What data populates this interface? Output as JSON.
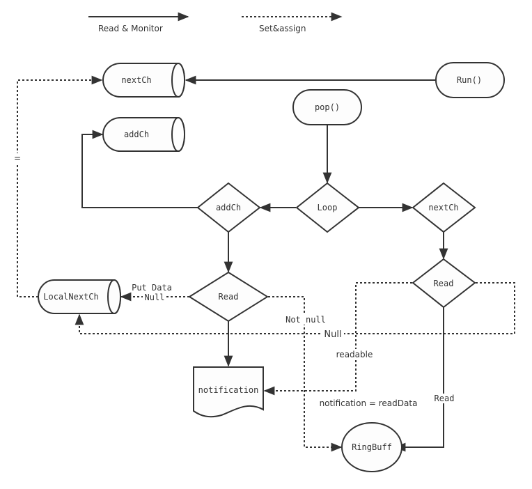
{
  "legend": {
    "solid_label": "Read & Monitor",
    "dotted_label": "Set&assign"
  },
  "nodes": {
    "nextch_store": "nextCh",
    "addch_store": "addCh",
    "run": "Run()",
    "pop": "pop()",
    "addch_decision": "addCh",
    "loop_decision": "Loop",
    "nextch_decision": "nextCh",
    "local_nextch_store": "LocalNextCh",
    "read_left_decision": "Read",
    "read_right_decision": "Read",
    "notification_doc": "notification",
    "ringbuff": "RingBuff"
  },
  "edge_labels": {
    "equals": "=",
    "put_data": "Put Data",
    "null_left": "Null",
    "not_null": "Not null",
    "null_mid": "Null",
    "readable": "readable",
    "notification_assign": "notification = readData",
    "read_vertical": "Read"
  },
  "colors": {
    "stroke": "#333333",
    "fill": "#fdfdfd",
    "background": "#ffffff"
  }
}
